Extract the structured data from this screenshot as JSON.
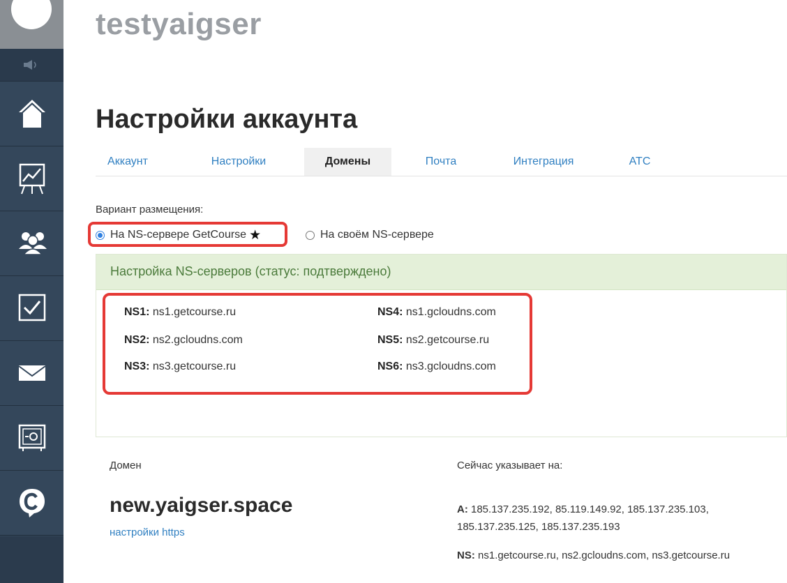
{
  "app": {
    "title": "testyaigser"
  },
  "sidebar": {
    "items": [
      {
        "icon": "sound-icon"
      },
      {
        "icon": "home-icon"
      },
      {
        "icon": "chart-icon"
      },
      {
        "icon": "users-icon"
      },
      {
        "icon": "tasks-checkbox-icon"
      },
      {
        "icon": "mail-icon"
      },
      {
        "icon": "safe-icon"
      },
      {
        "icon": "getcourse-logo-icon"
      }
    ]
  },
  "page": {
    "title": "Настройки аккаунта"
  },
  "tabs": [
    {
      "label": "Аккаунт",
      "active": false
    },
    {
      "label": "Настройки",
      "active": false
    },
    {
      "label": "Домены",
      "active": true
    },
    {
      "label": "Почта",
      "active": false
    },
    {
      "label": "Интеграция",
      "active": false
    },
    {
      "label": "АТС",
      "active": false
    }
  ],
  "hosting": {
    "label": "Вариант размещения:",
    "options": [
      {
        "label": "На NS-сервере GetCourse",
        "badge": "★",
        "checked": true
      },
      {
        "label": "На своём NS-сервере",
        "checked": false
      }
    ]
  },
  "ns_panel": {
    "title": "Настройка NS-серверов (статус: подтверждено)",
    "servers": [
      {
        "key": "NS1:",
        "value": "ns1.getcourse.ru"
      },
      {
        "key": "NS2:",
        "value": "ns2.gcloudns.com"
      },
      {
        "key": "NS3:",
        "value": "ns3.getcourse.ru"
      },
      {
        "key": "NS4:",
        "value": "ns1.gcloudns.com"
      },
      {
        "key": "NS5:",
        "value": "ns2.getcourse.ru"
      },
      {
        "key": "NS6:",
        "value": "ns3.gcloudns.com"
      }
    ]
  },
  "domain": {
    "col_domain": "Домен",
    "col_points": "Сейчас указывает на:",
    "name": "new.yaigser.space",
    "https_link": "настройки https",
    "a_key": "A:",
    "a_value_line1": "185.137.235.192, 85.119.149.92, 185.137.235.103,",
    "a_value_line2": "185.137.235.125, 185.137.235.193",
    "ns_key": "NS:",
    "ns_value": "ns1.getcourse.ru, ns2.gcloudns.com, ns3.getcourse.ru"
  },
  "colors": {
    "accent": "#2f7fc1",
    "highlight": "#e53935",
    "panel_bg": "#e4f0d9",
    "sidebar": "#2e3f52"
  }
}
